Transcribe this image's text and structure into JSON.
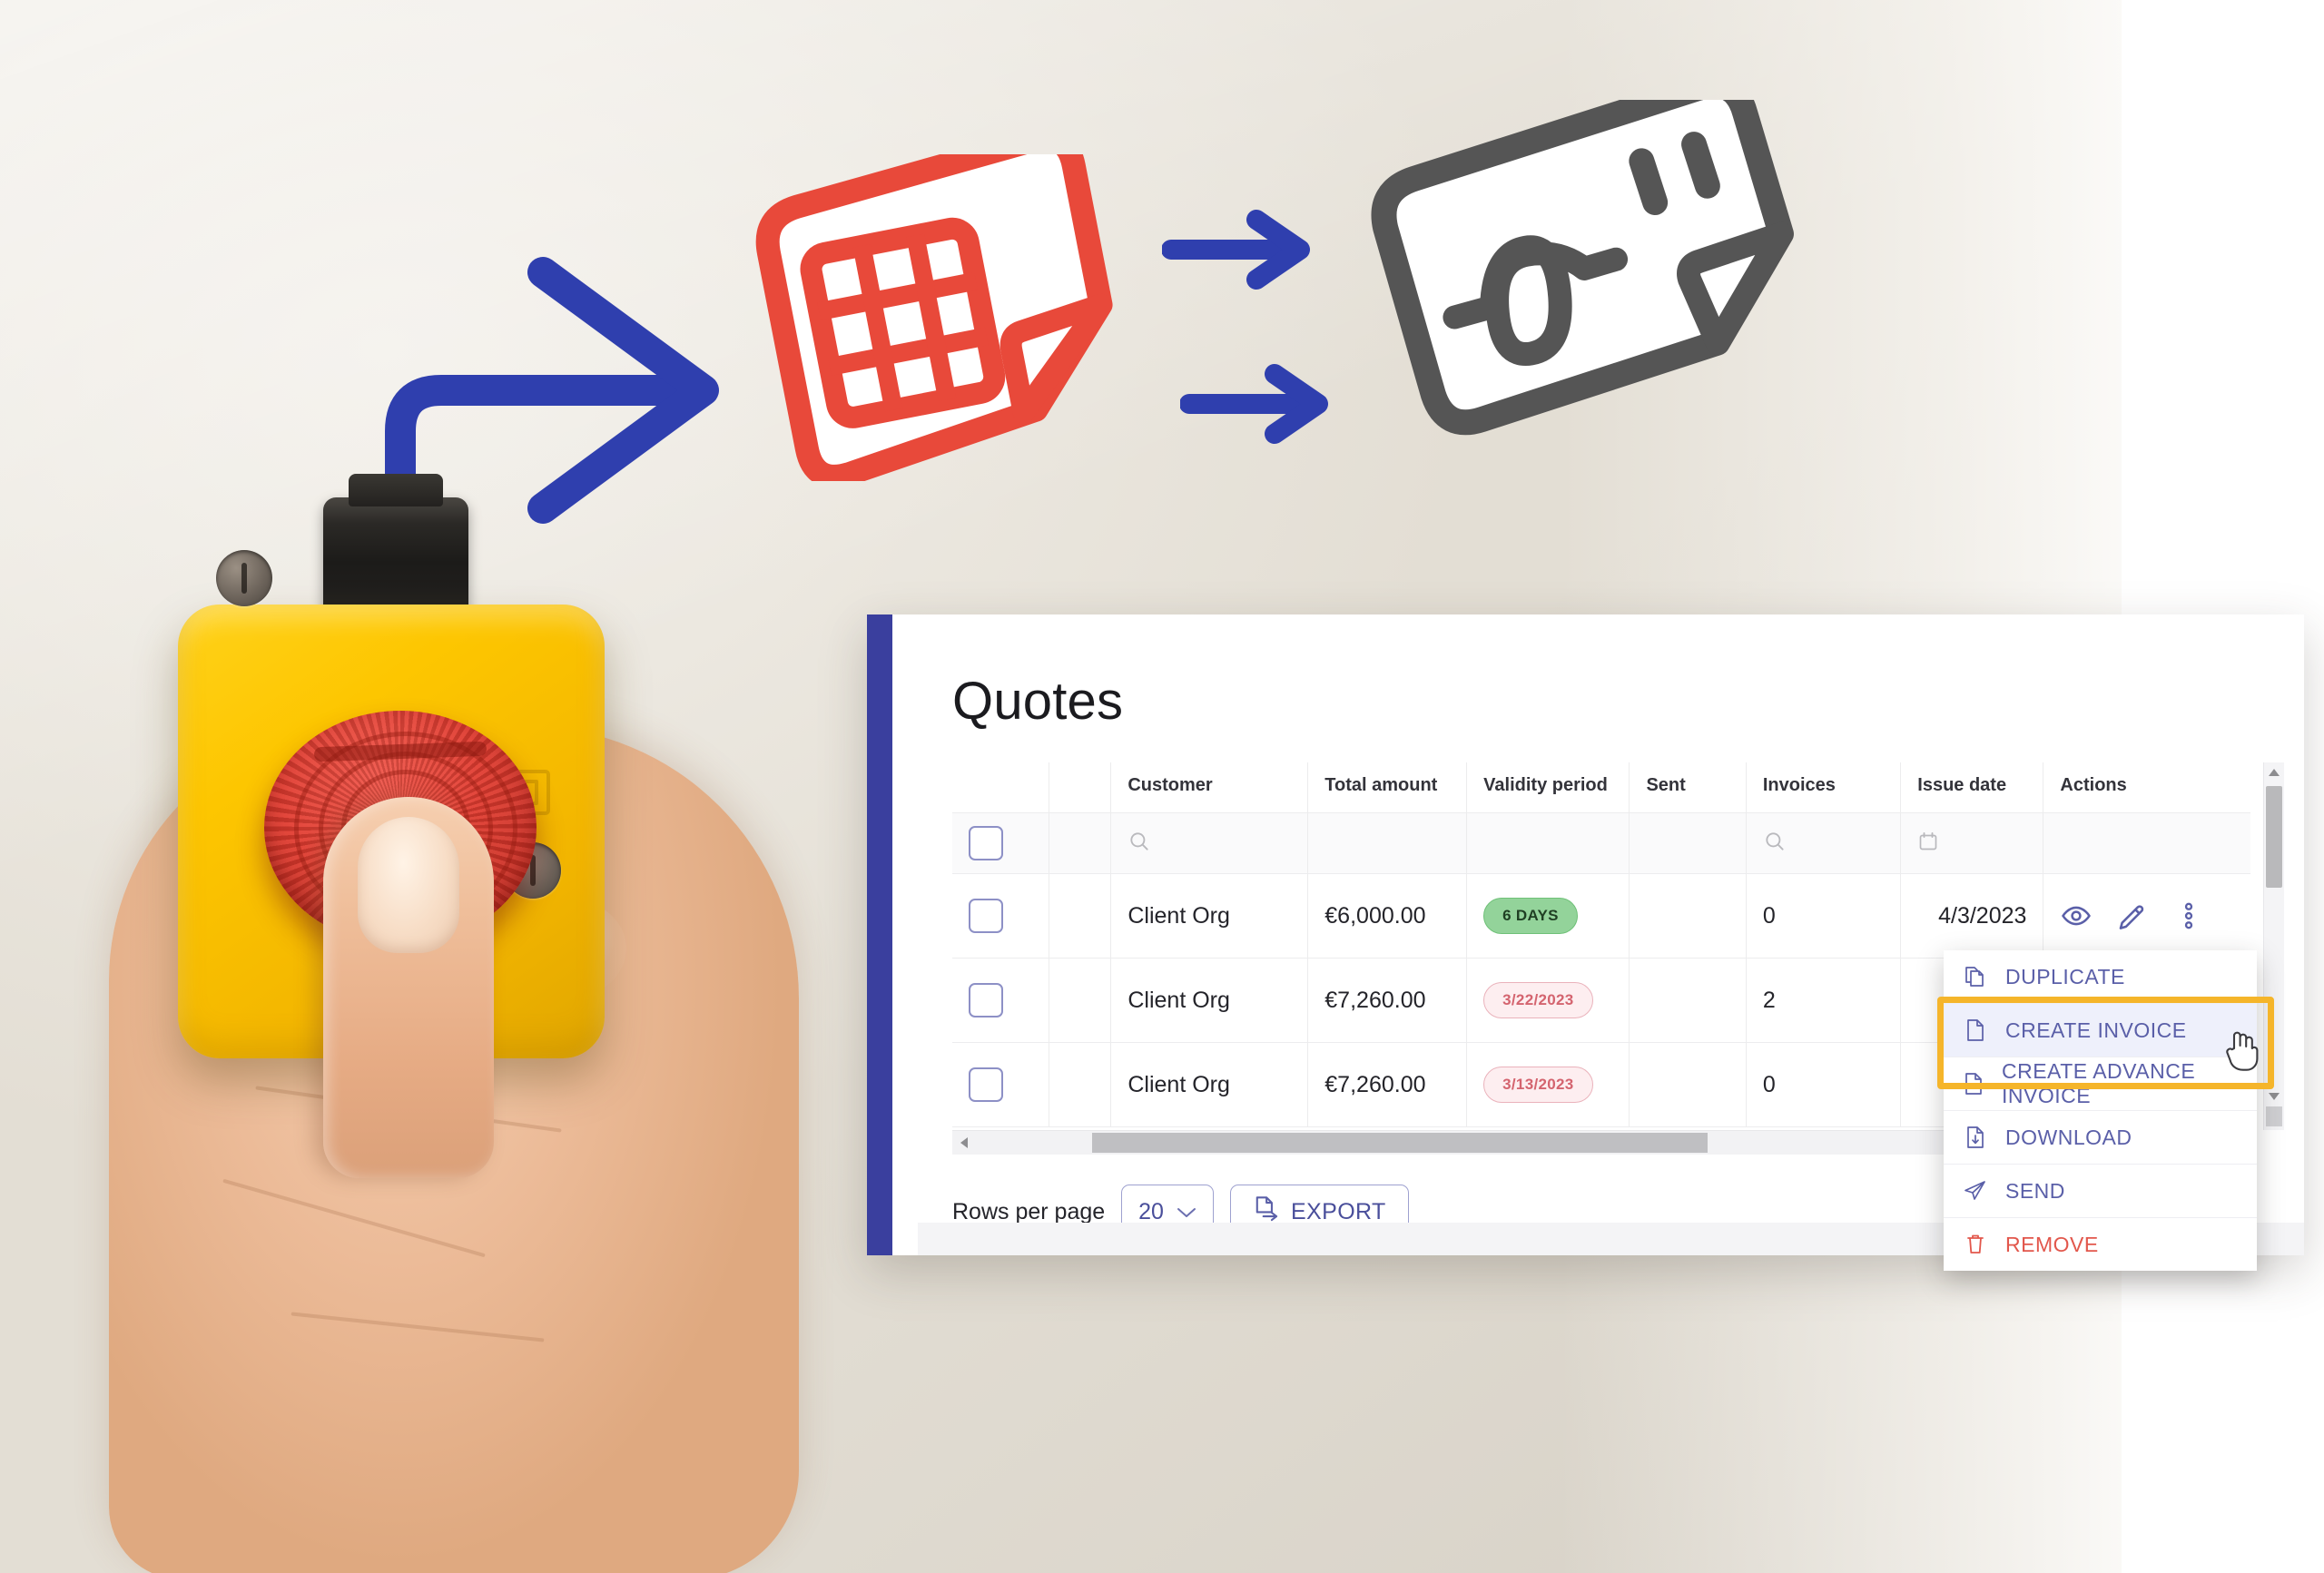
{
  "page": {
    "title": "Quotes"
  },
  "table": {
    "headers": [
      "",
      "",
      "Customer",
      "Total amount",
      "Validity period",
      "Sent",
      "Invoices",
      "Issue date",
      "Actions"
    ],
    "filter_row": {
      "customer_icon": "search-icon",
      "invoices_icon": "search-icon",
      "issue_date_icon": "calendar-icon"
    },
    "rows": [
      {
        "customer": "Client Org",
        "total_amount": "€6,000.00",
        "validity_period": "6 DAYS",
        "validity_style": "green",
        "sent": "",
        "invoices": "0",
        "issue_date": "4/3/2023",
        "actions": [
          "eye-icon",
          "pencil-icon",
          "more-vertical-icon"
        ]
      },
      {
        "customer": "Client Org",
        "total_amount": "€7,260.00",
        "validity_period": "3/22/2023",
        "validity_style": "pink",
        "sent": "",
        "invoices": "2",
        "issue_date": "",
        "actions": []
      },
      {
        "customer": "Client Org",
        "total_amount": "€7,260.00",
        "validity_period": "3/13/2023",
        "validity_style": "pink",
        "sent": "",
        "invoices": "0",
        "issue_date": "",
        "actions": []
      }
    ]
  },
  "footer": {
    "rows_per_page_label": "Rows per page",
    "rows_per_page_value": "20",
    "export_label": "EXPORT",
    "export_icon": "export-file-icon",
    "chevron_icon": "chevron-down-icon"
  },
  "context_menu": {
    "items": [
      {
        "label": "DUPLICATE",
        "icon": "duplicate-icon",
        "selected": false,
        "danger": false
      },
      {
        "label": "CREATE INVOICE",
        "icon": "file-icon",
        "selected": true,
        "danger": false
      },
      {
        "label": "CREATE ADVANCE INVOICE",
        "icon": "file-icon",
        "selected": false,
        "danger": false
      },
      {
        "label": "DOWNLOAD",
        "icon": "file-download-icon",
        "selected": false,
        "danger": false
      },
      {
        "label": "SEND",
        "icon": "send-paper-plane-icon",
        "selected": false,
        "danger": false
      },
      {
        "label": "REMOVE",
        "icon": "trash-icon",
        "selected": false,
        "danger": true
      }
    ]
  },
  "colors": {
    "accent_blue": "#3a3f9e",
    "menu_text": "#5a5fa8",
    "danger_red": "#e2574c",
    "highlight_gold": "#f5b52a",
    "badge_green_bg": "#93d39a",
    "badge_pink_bg": "#fdeef0",
    "badge_pink_text": "#d4646f",
    "quote_icon_red": "#e8493a",
    "invoice_icon_grey": "#555555",
    "arrow_blue": "#2f3fae",
    "button_yellow": "#fdc600",
    "button_red": "#e13c30"
  },
  "illustration": {
    "quote_icon": "quote-document-icon",
    "invoice_icon": "invoice-document-icon",
    "elbow_arrow": "elbow-arrow-icon",
    "arrow_1": "arrow-right-icon",
    "arrow_2": "arrow-right-icon",
    "emergency_button": "emergency-stop-button",
    "hand": "hand-pressing-button"
  }
}
